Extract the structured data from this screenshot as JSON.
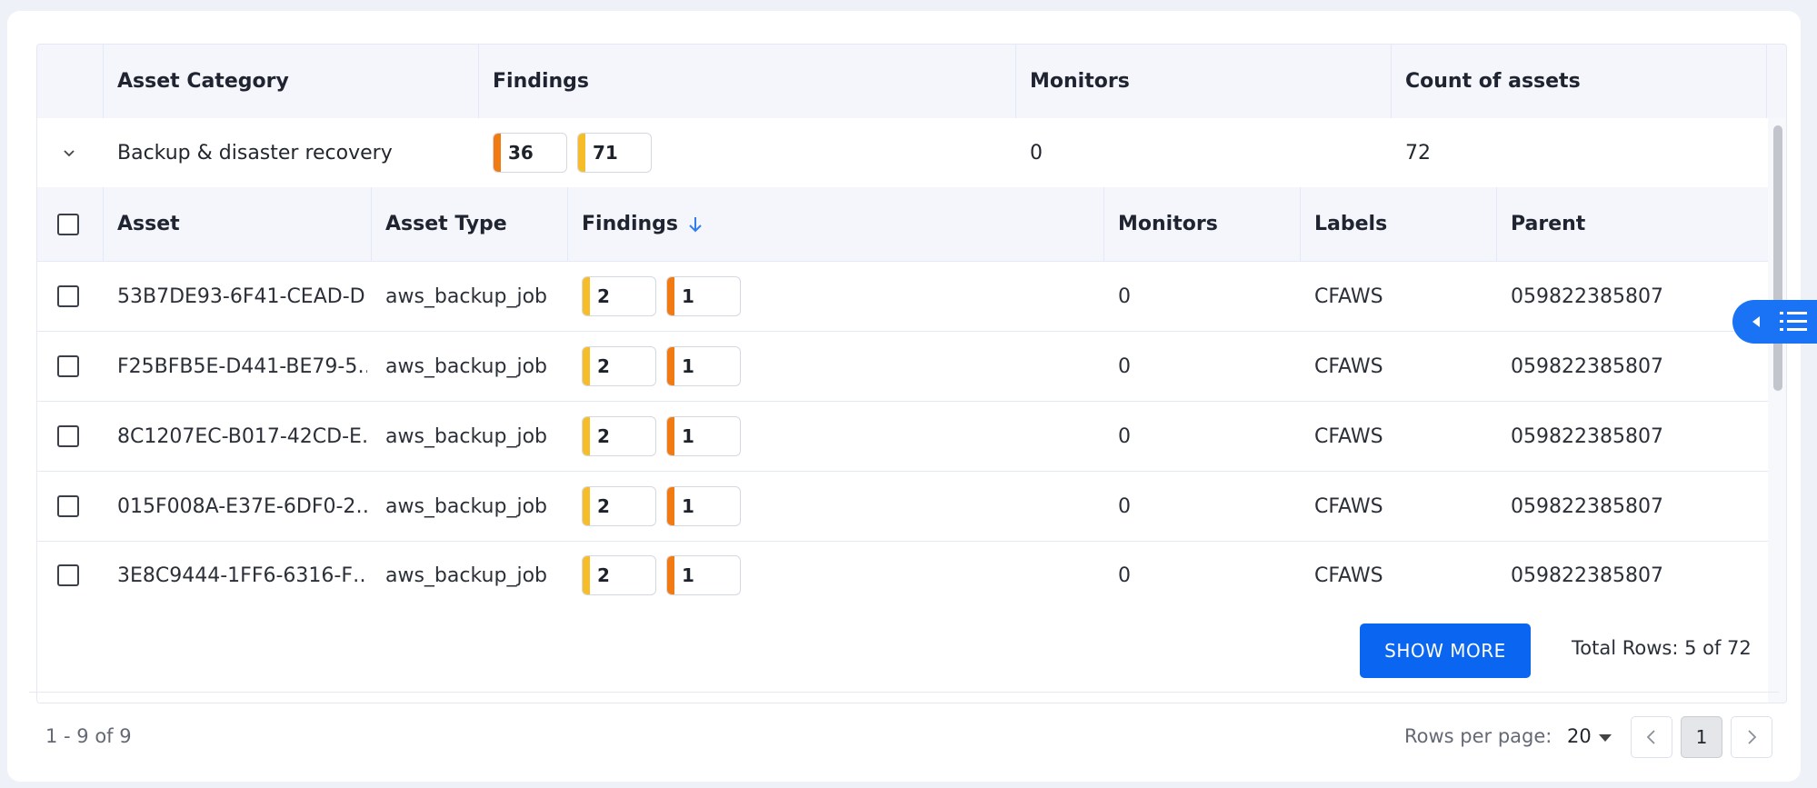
{
  "outer_table": {
    "columns": [
      "Asset Category",
      "Findings",
      "Monitors",
      "Count of assets"
    ],
    "group": {
      "category": "Backup & disaster recovery",
      "findings": [
        {
          "value": "36",
          "severity_color": "#f27a12"
        },
        {
          "value": "71",
          "severity_color": "#f6bd28"
        }
      ],
      "monitors": "0",
      "count": "72"
    }
  },
  "inner_table": {
    "columns": [
      "Asset",
      "Asset Type",
      "Findings",
      "Monitors",
      "Labels",
      "Parent"
    ],
    "sort_icon": "arrow-down-icon",
    "rows": [
      {
        "asset": "53B7DE93-6F41-CEAD-D…",
        "type": "aws_backup_job",
        "findings": [
          "2",
          "1"
        ],
        "monitors": "0",
        "labels": "CFAWS",
        "parent": "059822385807"
      },
      {
        "asset": "F25BFB5E-D441-BE79-5…",
        "type": "aws_backup_job",
        "findings": [
          "2",
          "1"
        ],
        "monitors": "0",
        "labels": "CFAWS",
        "parent": "059822385807"
      },
      {
        "asset": "8C1207EC-B017-42CD-E…",
        "type": "aws_backup_job",
        "findings": [
          "2",
          "1"
        ],
        "monitors": "0",
        "labels": "CFAWS",
        "parent": "059822385807"
      },
      {
        "asset": "015F008A-E37E-6DF0-2…",
        "type": "aws_backup_job",
        "findings": [
          "2",
          "1"
        ],
        "monitors": "0",
        "labels": "CFAWS",
        "parent": "059822385807"
      },
      {
        "asset": "3E8C9444-1FF6-6316-F…",
        "type": "aws_backup_job",
        "findings": [
          "2",
          "1"
        ],
        "monitors": "0",
        "labels": "CFAWS",
        "parent": "059822385807"
      }
    ],
    "show_more_label": "SHOW MORE",
    "total_rows": "Total Rows: 5 of 72"
  },
  "pagination": {
    "range": "1 - 9 of 9",
    "rows_per_page_label": "Rows per page:",
    "rows_per_page_value": "20",
    "current_page": "1"
  },
  "colors": {
    "accent": "#0a66f0",
    "high": "#f27a12",
    "medium": "#f6bd28"
  }
}
